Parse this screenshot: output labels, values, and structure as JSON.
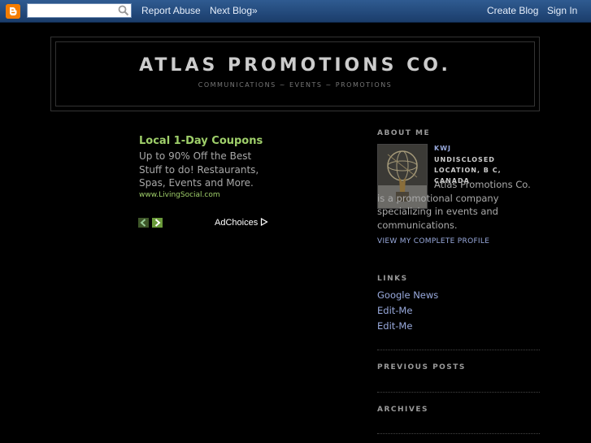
{
  "navbar": {
    "search_placeholder": "",
    "report_abuse": "Report Abuse",
    "next_blog": "Next Blog»",
    "create_blog": "Create Blog",
    "sign_in": "Sign In"
  },
  "header": {
    "title": "ATLAS PROMOTIONS CO.",
    "description": "COMMUNICATIONS ~ EVENTS ~ PROMOTIONS"
  },
  "ad": {
    "title": "Local 1-Day Coupons",
    "body": "Up to 90% Off the Best Stuff to do! Restaurants, Spas, Events and More.",
    "url": "www.LivingSocial.com",
    "adchoices": "AdChoices"
  },
  "sidebar": {
    "about_heading": "ABOUT ME",
    "profile_name": "KWJ",
    "profile_location": "UNDISCLOSED LOCATION, B C, CANADA",
    "profile_about": "Atlas Promotions Co. is a promotional company specializing in events and communications.",
    "profile_link": "VIEW MY COMPLETE PROFILE",
    "links_heading": "LINKS",
    "links": [
      {
        "label": "Google News"
      },
      {
        "label": "Edit-Me"
      },
      {
        "label": "Edit-Me"
      }
    ],
    "previous_posts_heading": "PREVIOUS POSTS",
    "archives_heading": "ARCHIVES"
  },
  "colors": {
    "background": "#000000",
    "navbar": "#1f4575",
    "link": "#99aadd",
    "ad_green": "#9fcf6a",
    "blogger_orange": "#f57d00"
  }
}
